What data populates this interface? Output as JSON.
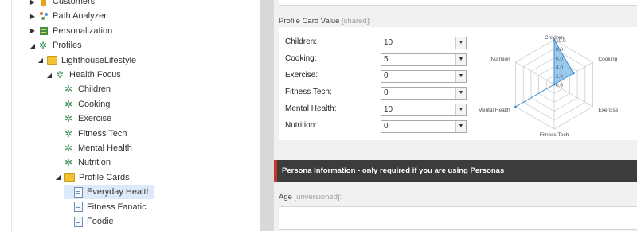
{
  "tree": {
    "items": [
      {
        "label": "Customers",
        "depth": 1,
        "icon": "customers-icon",
        "toggle": "▶"
      },
      {
        "label": "Path Analyzer",
        "depth": 1,
        "icon": "path-analyzer-icon",
        "toggle": "▶"
      },
      {
        "label": "Personalization",
        "depth": 1,
        "icon": "personalization-icon",
        "toggle": "▶"
      },
      {
        "label": "Profiles",
        "depth": 1,
        "icon": "gear-icon",
        "toggle": "◢"
      },
      {
        "label": "LighthouseLifestyle",
        "depth": 2,
        "icon": "folder-icon",
        "toggle": "◢"
      },
      {
        "label": "Health Focus",
        "depth": 3,
        "icon": "gear-icon",
        "toggle": "◢"
      },
      {
        "label": "Children",
        "depth": 4,
        "icon": "gear-icon",
        "toggle": ""
      },
      {
        "label": "Cooking",
        "depth": 4,
        "icon": "gear-icon",
        "toggle": ""
      },
      {
        "label": "Exercise",
        "depth": 4,
        "icon": "gear-icon",
        "toggle": ""
      },
      {
        "label": "Fitness Tech",
        "depth": 4,
        "icon": "gear-icon",
        "toggle": ""
      },
      {
        "label": "Mental Health",
        "depth": 4,
        "icon": "gear-icon",
        "toggle": ""
      },
      {
        "label": "Nutrition",
        "depth": 4,
        "icon": "gear-icon",
        "toggle": ""
      },
      {
        "label": "Profile Cards",
        "depth": 4,
        "icon": "folder-icon",
        "toggle": "◢"
      },
      {
        "label": "Everyday Health",
        "depth": 5,
        "icon": "document-icon",
        "toggle": "",
        "selected": true
      },
      {
        "label": "Fitness Fanatic",
        "depth": 5,
        "icon": "document-icon",
        "toggle": ""
      },
      {
        "label": "Foodie",
        "depth": 5,
        "icon": "document-icon",
        "toggle": ""
      }
    ]
  },
  "profile_card": {
    "label": "Profile Card Value",
    "shared": "[shared]:",
    "rows": [
      {
        "label": "Children:",
        "value": "10"
      },
      {
        "label": "Cooking:",
        "value": "5"
      },
      {
        "label": "Exercise:",
        "value": "0"
      },
      {
        "label": "Fitness Tech:",
        "value": "0"
      },
      {
        "label": "Mental Health:",
        "value": "10"
      },
      {
        "label": "Nutrition:",
        "value": "0"
      }
    ]
  },
  "chart_data": {
    "type": "radar",
    "categories": [
      "Children",
      "Cooking",
      "Exercise",
      "Fitness Tech",
      "Mental Health",
      "Nutrition"
    ],
    "values": [
      10,
      5,
      0,
      0,
      10,
      0
    ],
    "ticks": [
      "0.0",
      "2.0",
      "4.0",
      "6.0",
      "8.0",
      "10.0"
    ],
    "ylim": [
      0,
      10
    ],
    "fill_color": "#7ab8ea",
    "line_color": "#3a8fd6"
  },
  "persona": {
    "header": "Persona Information - only required if you are using Personas"
  },
  "age": {
    "label": "Age",
    "unversioned": "[unversioned]:"
  },
  "colors": {
    "accent_red": "#c9332f",
    "header_dark": "#3c3c3c",
    "selected_bg": "#dceaf9"
  }
}
